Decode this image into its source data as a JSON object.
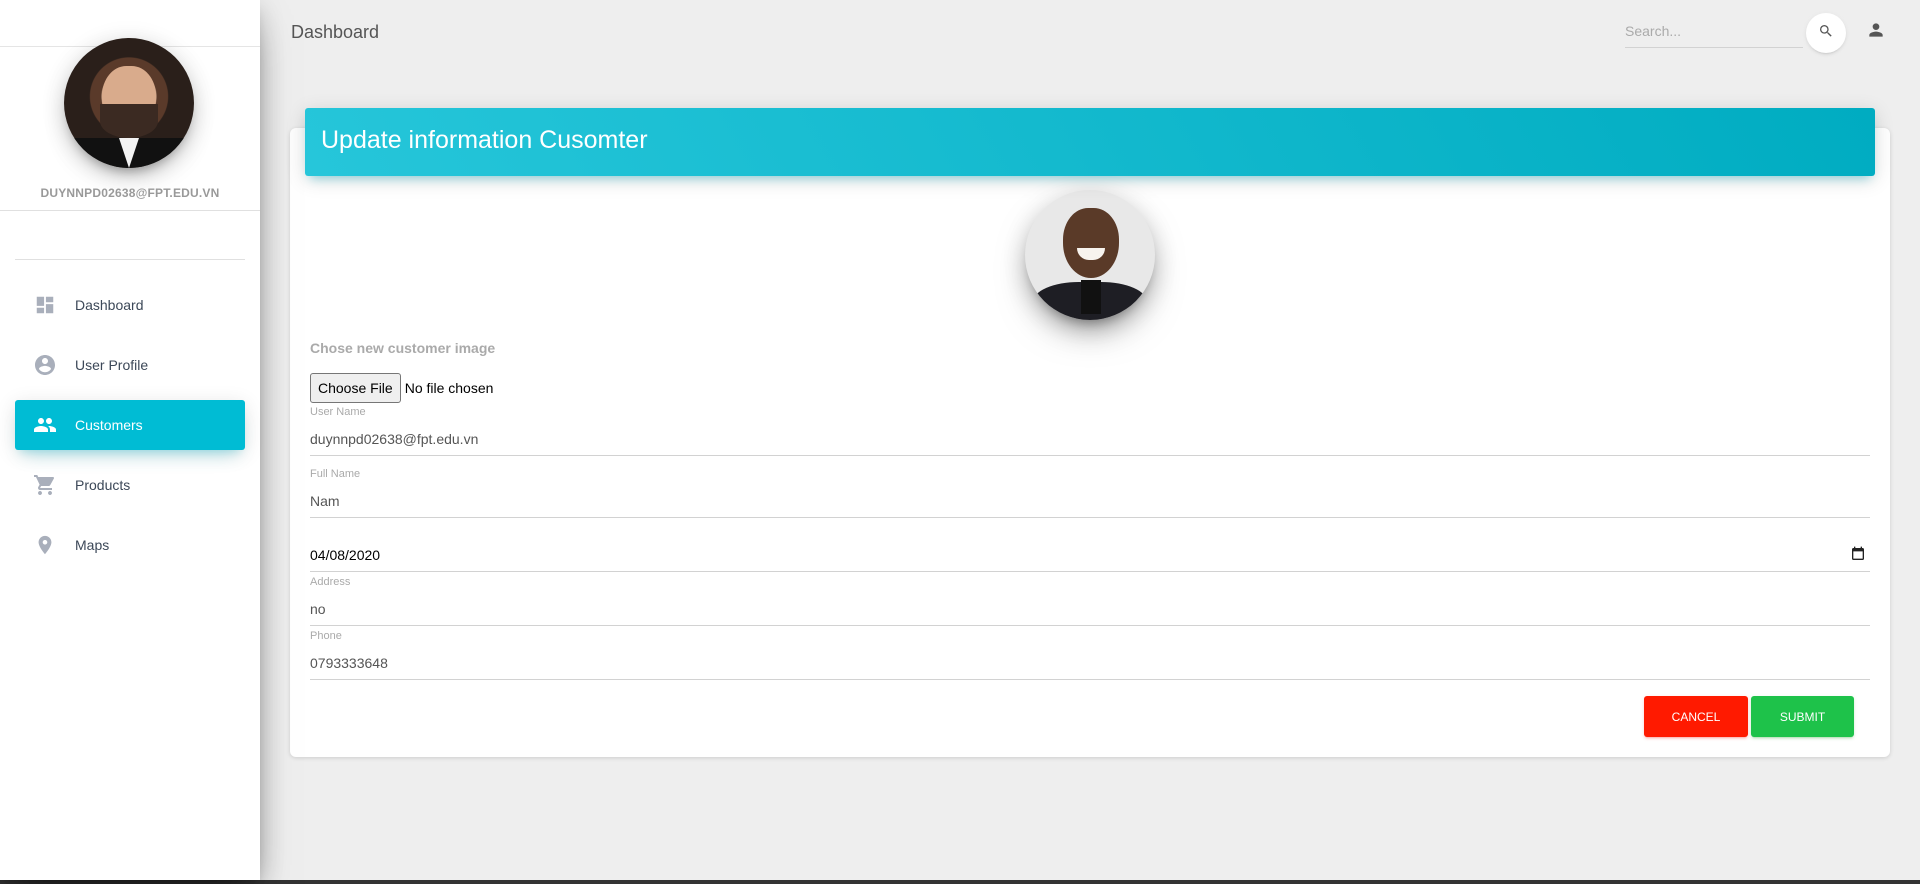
{
  "sidebar": {
    "user_email": "DUYNNPD02638@FPT.EDU.VN",
    "items": [
      {
        "label": "Dashboard",
        "icon": "dashboard-icon"
      },
      {
        "label": "User Profile",
        "icon": "account-circle-icon"
      },
      {
        "label": "Customers",
        "icon": "people-icon",
        "active": true
      },
      {
        "label": "Products",
        "icon": "shopping-cart-icon"
      },
      {
        "label": "Maps",
        "icon": "location-pin-icon"
      }
    ]
  },
  "topbar": {
    "title": "Dashboard",
    "search_placeholder": "Search..."
  },
  "card": {
    "title": "Update information Cusomter",
    "image_label": "Chose new customer image",
    "file_button": "Choose File",
    "file_status": "No file chosen",
    "fields": {
      "username": {
        "label": "User Name",
        "value": "duynnpd02638@fpt.edu.vn"
      },
      "fullname": {
        "label": "Full Name",
        "value": "Nam"
      },
      "birthday": {
        "value": "04/08/2020"
      },
      "address": {
        "label": "Address",
        "value": "no"
      },
      "phone": {
        "label": "Phone",
        "value": "0793333648"
      }
    },
    "cancel_label": "CANCEL",
    "submit_label": "SUBMIT"
  },
  "colors": {
    "accent": "#00bcd4",
    "cancel": "#ff1a00",
    "submit": "#1ec24a"
  }
}
